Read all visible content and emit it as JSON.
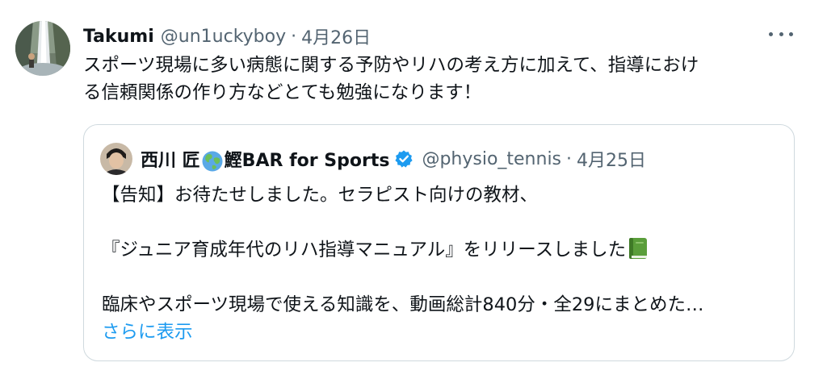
{
  "tweet": {
    "display_name": "Takumi",
    "handle": "@un1uckyboy",
    "separator": "·",
    "date": "4月26日",
    "text_line1": "スポーツ現場に多い病態に関する予防やリハの考え方に加えて、指導におけ",
    "text_line2": "る信頼関係の作り方などとても勉強になります！",
    "more_icon": "ellipsis-icon"
  },
  "quoted": {
    "display_name_prefix": "西川 匠",
    "globe_icon": "globe-asia-emoji",
    "display_name_suffix": "鰹BAR for Sports",
    "verified_icon": "verified-badge-icon",
    "handle": "@physio_tennis",
    "separator": "·",
    "date": "4月25日",
    "body_line1": "【告知】お待たせしました。セラピスト向けの教材、",
    "body_line2": "『ジュニア育成年代のリハ指導マニュアル』をリリースしました",
    "book_icon": "green-book-emoji",
    "body_line3": "臨床やスポーツ現場で使える知識を、動画総計840分・全29にまとめた…",
    "show_more": "さらに表示"
  },
  "colors": {
    "text_primary": "#0f1419",
    "text_secondary": "#536471",
    "link": "#1d9bf0",
    "border": "#cfd9de",
    "verified": "#1d9bf0"
  }
}
